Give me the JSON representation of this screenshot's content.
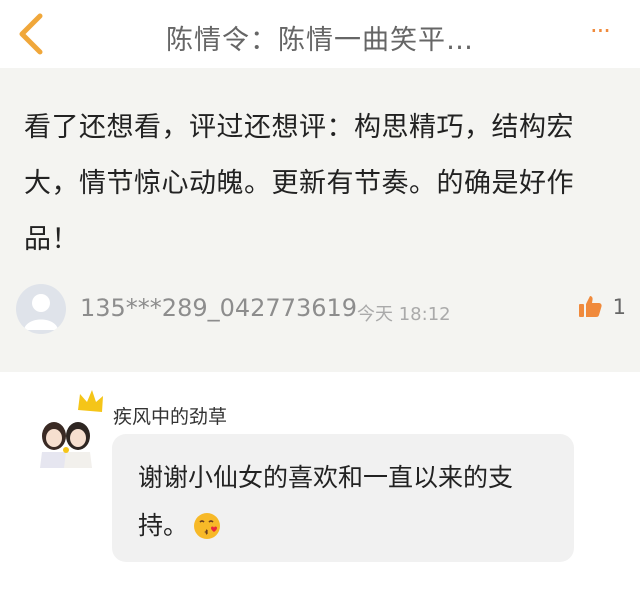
{
  "header": {
    "title": "陈情令：陈情一曲笑平…",
    "back_icon": "chevron-left-icon",
    "more_icon": "more-dots-icon",
    "accent_color": "#f08a3c"
  },
  "comment": {
    "text": "看了还想看，评过还想评：构思精巧，结构宏大，情节惊心动魄。更新有节奏。的确是好作品！",
    "username": "135***289_042773619",
    "time": "今天 18:12",
    "like_icon": "thumbs-up-icon",
    "like_count": "1"
  },
  "reply": {
    "name": "疾风中的劲草",
    "text": "谢谢小仙女的喜欢和一直以来的支持。",
    "emoji": "kissing-heart-emoji"
  }
}
